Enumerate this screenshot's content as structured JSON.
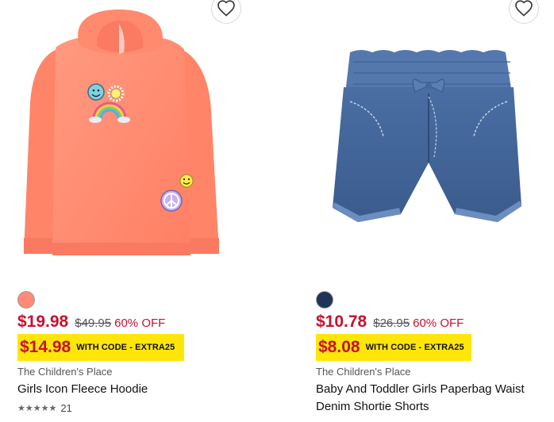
{
  "products": [
    {
      "swatch_color": "#ff8a75",
      "sale_price": "$19.98",
      "original_price": "$49.95",
      "discount": "60% OFF",
      "promo_price": "$14.98",
      "promo_code_text": "WITH CODE - EXTRA25",
      "brand": "The Children's Place",
      "name": "Girls Icon Fleece Hoodie",
      "stars": "★★★★★",
      "review_count": "21",
      "image_icon": "hoodie-image"
    },
    {
      "swatch_color": "#1f3558",
      "sale_price": "$10.78",
      "original_price": "$26.95",
      "discount": "60% OFF",
      "promo_price": "$8.08",
      "promo_code_text": "WITH CODE - EXTRA25",
      "brand": "The Children's Place",
      "name": "Baby And Toddler Girls Paperbag Waist Denim Shortie Shorts",
      "image_icon": "denim-shorts-image"
    }
  ],
  "colors": {
    "sale_red": "#c8102e",
    "promo_yellow": "#ffe60a",
    "hoodie_orange": "#ff8a6e",
    "denim_blue": "#3d5f93"
  },
  "icons": {
    "favorite": "heart-outline-icon",
    "rating": "star-icon"
  }
}
